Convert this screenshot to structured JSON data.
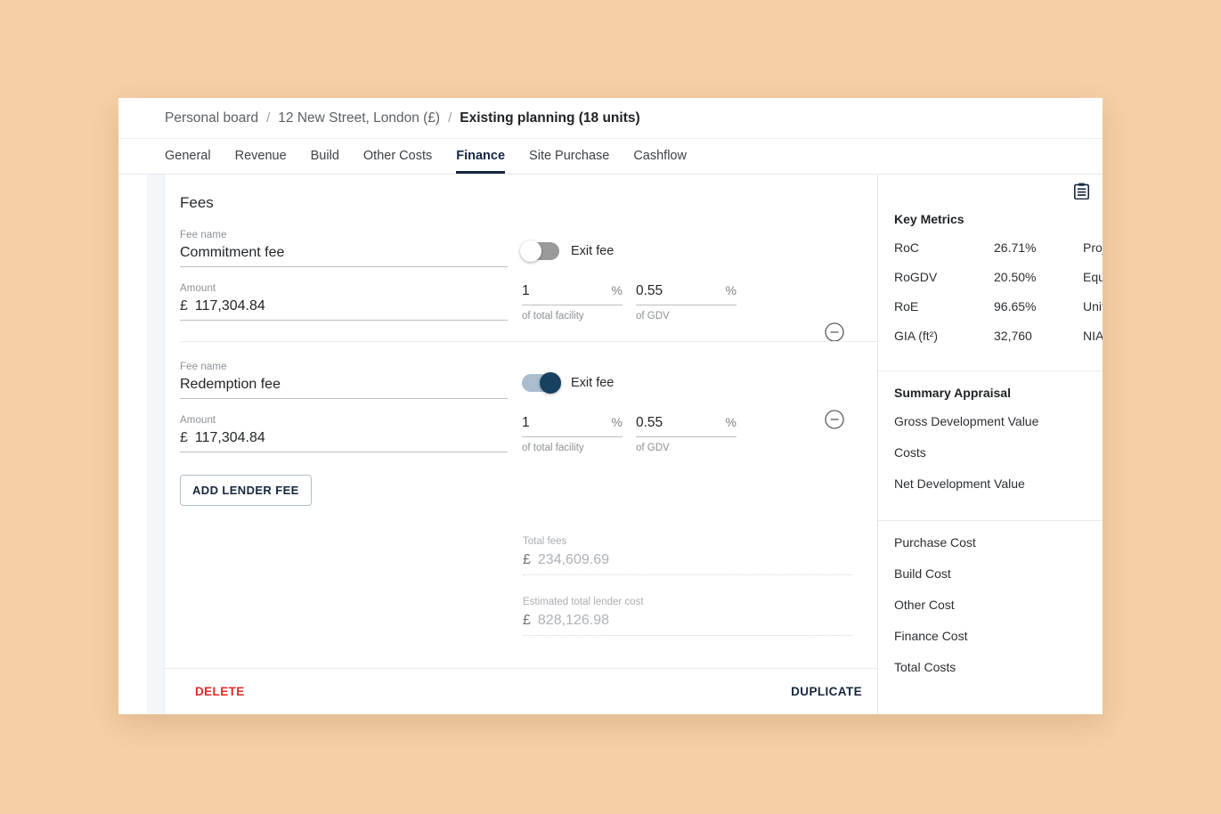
{
  "breadcrumb": {
    "items": [
      "Personal board",
      "12 New Street, London (£)",
      "Existing planning (18 units)"
    ],
    "separator": "/"
  },
  "tabs": [
    {
      "label": "General",
      "active": false
    },
    {
      "label": "Revenue",
      "active": false
    },
    {
      "label": "Build",
      "active": false
    },
    {
      "label": "Other Costs",
      "active": false
    },
    {
      "label": "Finance",
      "active": true
    },
    {
      "label": "Site Purchase",
      "active": false
    },
    {
      "label": "Cashflow",
      "active": false
    }
  ],
  "main": {
    "section_title": "Fees",
    "labels": {
      "fee_name": "Fee name",
      "amount": "Amount",
      "currency": "£",
      "percent": "%",
      "of_total_facility": "of total facility",
      "of_gdv": "of GDV",
      "exit_fee": "Exit fee"
    },
    "fees": [
      {
        "name": "Commitment fee",
        "amount": "117,304.84",
        "pct_facility": "1",
        "pct_gdv": "0.55",
        "exit_fee_on": false
      },
      {
        "name": "Redemption fee",
        "amount": "117,304.84",
        "pct_facility": "1",
        "pct_gdv": "0.55",
        "exit_fee_on": true
      }
    ],
    "add_button": "ADD LENDER FEE",
    "totals": [
      {
        "label": "Total fees",
        "currency": "£",
        "value": "234,609.69"
      },
      {
        "label": "Estimated total lender cost",
        "currency": "£",
        "value": "828,126.98"
      }
    ]
  },
  "actions": {
    "delete": "DELETE",
    "duplicate": "DUPLICATE"
  },
  "sidebar": {
    "key_metrics_heading": "Key Metrics",
    "key_metrics": [
      {
        "label": "RoC",
        "value": "26.71%",
        "label2": "Proje"
      },
      {
        "label": "RoGDV",
        "value": "20.50%",
        "label2": "Equit"
      },
      {
        "label": "RoE",
        "value": "96.65%",
        "label2": "Units"
      },
      {
        "label": "GIA (ft²)",
        "value": "32,760",
        "label2": "NIA ("
      }
    ],
    "summary_heading": "Summary Appraisal",
    "summary_items": [
      "Gross Development Value",
      "Costs",
      "Net Development Value"
    ],
    "cost_items": [
      "Purchase Cost",
      "Build Cost",
      "Other Cost",
      "Finance Cost",
      "Total Costs"
    ]
  },
  "colors": {
    "page_background": "#f6cfa6",
    "accent_navy": "#16283f",
    "delete_red": "#e02a2a",
    "toggle_on_knob": "#17415f",
    "toggle_on_track": "#a9bdce",
    "toggle_off_track": "#9a9a9a"
  }
}
